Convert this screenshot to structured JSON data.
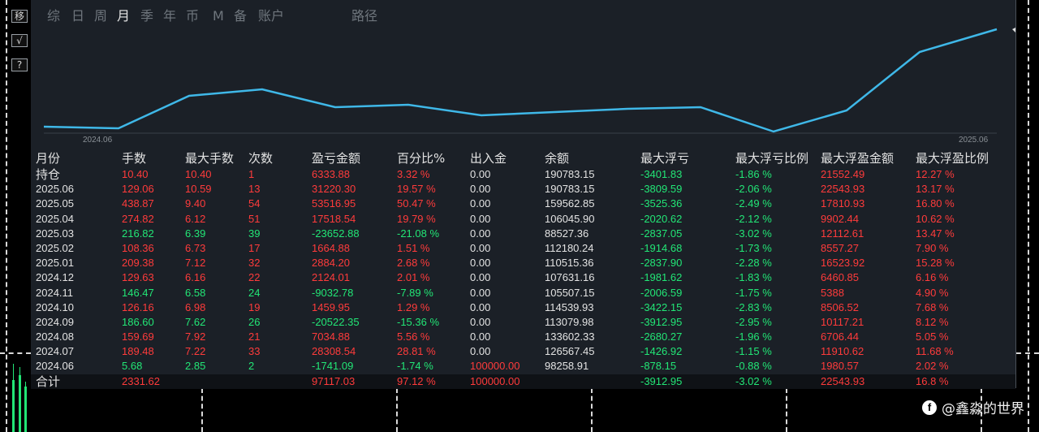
{
  "toolbar": {
    "move_label": "移",
    "check_label": "√",
    "help_label": "?"
  },
  "tabs": [
    {
      "label": "综",
      "active": false
    },
    {
      "label": "日",
      "active": false
    },
    {
      "label": "周",
      "active": false
    },
    {
      "label": "月",
      "active": true
    },
    {
      "label": "季",
      "active": false
    },
    {
      "label": "年",
      "active": false
    },
    {
      "label": "币",
      "active": false
    },
    {
      "label": "M",
      "active": false
    },
    {
      "label": "备",
      "active": false
    },
    {
      "label": "账户",
      "active": false
    },
    {
      "label": "路径",
      "active": false
    }
  ],
  "chart": {
    "x_start_label": "2024.06",
    "x_end_label": "2025.06",
    "line_color": "#3fb8e8",
    "series": [
      5.68,
      2.85,
      107631.16,
      110515.36,
      112180.24,
      88527.36,
      106045.9,
      159562.85,
      190783.15
    ]
  },
  "table": {
    "headers": [
      "月份",
      "手数",
      "最大手数",
      "次数",
      "盈亏金额",
      "百分比%",
      "出入金",
      "余额",
      "最大浮亏",
      "最大浮亏比例",
      "最大浮盈金额",
      "最大浮盈比例"
    ],
    "holding": {
      "label": "持仓",
      "lots": "10.40",
      "max_lots": "10.40",
      "count": "1",
      "pnl": "6333.88",
      "pct": "3.32 %",
      "flow": "0.00",
      "balance": "190783.15",
      "max_dd": "-3401.83",
      "max_dd_pct": "-1.86 %",
      "max_fp": "21552.49",
      "max_fp_pct": "12.27 %"
    },
    "rows": [
      {
        "month": "2025.06",
        "lots": "129.06",
        "max_lots": "10.59",
        "count": "13",
        "pnl": "31220.30",
        "pct": "19.57 %",
        "flow": "0.00",
        "balance": "190783.15",
        "max_dd": "-3809.59",
        "max_dd_pct": "-2.06 %",
        "max_fp": "22543.93",
        "max_fp_pct": "13.17 %",
        "sign": "pos"
      },
      {
        "month": "2025.05",
        "lots": "438.87",
        "max_lots": "9.40",
        "count": "54",
        "pnl": "53516.95",
        "pct": "50.47 %",
        "flow": "0.00",
        "balance": "159562.85",
        "max_dd": "-3525.36",
        "max_dd_pct": "-2.49 %",
        "max_fp": "17810.93",
        "max_fp_pct": "16.80 %",
        "sign": "pos"
      },
      {
        "month": "2025.04",
        "lots": "274.82",
        "max_lots": "6.12",
        "count": "51",
        "pnl": "17518.54",
        "pct": "19.79 %",
        "flow": "0.00",
        "balance": "106045.90",
        "max_dd": "-2020.62",
        "max_dd_pct": "-2.12 %",
        "max_fp": "9902.44",
        "max_fp_pct": "10.62 %",
        "sign": "pos"
      },
      {
        "month": "2025.03",
        "lots": "216.82",
        "max_lots": "6.39",
        "count": "39",
        "pnl": "-23652.88",
        "pct": "-21.08 %",
        "flow": "0.00",
        "balance": "88527.36",
        "max_dd": "-2837.05",
        "max_dd_pct": "-3.02 %",
        "max_fp": "12112.61",
        "max_fp_pct": "13.47 %",
        "sign": "neg"
      },
      {
        "month": "2025.02",
        "lots": "108.36",
        "max_lots": "6.73",
        "count": "17",
        "pnl": "1664.88",
        "pct": "1.51 %",
        "flow": "0.00",
        "balance": "112180.24",
        "max_dd": "-1914.68",
        "max_dd_pct": "-1.73 %",
        "max_fp": "8557.27",
        "max_fp_pct": "7.90 %",
        "sign": "pos"
      },
      {
        "month": "2025.01",
        "lots": "209.38",
        "max_lots": "7.12",
        "count": "32",
        "pnl": "2884.20",
        "pct": "2.68 %",
        "flow": "0.00",
        "balance": "110515.36",
        "max_dd": "-2837.90",
        "max_dd_pct": "-2.28 %",
        "max_fp": "16523.92",
        "max_fp_pct": "15.28 %",
        "sign": "pos"
      },
      {
        "month": "2024.12",
        "lots": "129.63",
        "max_lots": "6.16",
        "count": "22",
        "pnl": "2124.01",
        "pct": "2.01 %",
        "flow": "0.00",
        "balance": "107631.16",
        "max_dd": "-1981.62",
        "max_dd_pct": "-1.83 %",
        "max_fp": "6460.85",
        "max_fp_pct": "6.16 %",
        "sign": "pos"
      },
      {
        "month": "2024.11",
        "lots": "146.47",
        "max_lots": "6.58",
        "count": "24",
        "pnl": "-9032.78",
        "pct": "-7.89 %",
        "flow": "0.00",
        "balance": "105507.15",
        "max_dd": "-2006.59",
        "max_dd_pct": "-1.75 %",
        "max_fp": "5388",
        "max_fp_pct": "4.90 %",
        "sign": "neg"
      },
      {
        "month": "2024.10",
        "lots": "126.16",
        "max_lots": "6.98",
        "count": "19",
        "pnl": "1459.95",
        "pct": "1.29 %",
        "flow": "0.00",
        "balance": "114539.93",
        "max_dd": "-3422.15",
        "max_dd_pct": "-2.83 %",
        "max_fp": "8506.52",
        "max_fp_pct": "7.68 %",
        "sign": "pos"
      },
      {
        "month": "2024.09",
        "lots": "186.60",
        "max_lots": "7.62",
        "count": "26",
        "pnl": "-20522.35",
        "pct": "-15.36 %",
        "flow": "0.00",
        "balance": "113079.98",
        "max_dd": "-3912.95",
        "max_dd_pct": "-2.95 %",
        "max_fp": "10117.21",
        "max_fp_pct": "8.12 %",
        "sign": "neg"
      },
      {
        "month": "2024.08",
        "lots": "159.69",
        "max_lots": "7.92",
        "count": "21",
        "pnl": "7034.88",
        "pct": "5.56 %",
        "flow": "0.00",
        "balance": "133602.33",
        "max_dd": "-2680.27",
        "max_dd_pct": "-1.96 %",
        "max_fp": "6706.44",
        "max_fp_pct": "5.05 %",
        "sign": "pos"
      },
      {
        "month": "2024.07",
        "lots": "189.48",
        "max_lots": "7.22",
        "count": "33",
        "pnl": "28308.54",
        "pct": "28.81 %",
        "flow": "0.00",
        "balance": "126567.45",
        "max_dd": "-1426.92",
        "max_dd_pct": "-1.15 %",
        "max_fp": "11910.62",
        "max_fp_pct": "11.68 %",
        "sign": "pos"
      },
      {
        "month": "2024.06",
        "lots": "5.68",
        "max_lots": "2.85",
        "count": "2",
        "pnl": "-1741.09",
        "pct": "-1.74 %",
        "flow": "100000.00",
        "balance": "98258.91",
        "max_dd": "-878.15",
        "max_dd_pct": "-0.88 %",
        "max_fp": "1980.57",
        "max_fp_pct": "2.02 %",
        "sign": "neg"
      }
    ],
    "total": {
      "label": "合计",
      "lots": "2331.62",
      "pnl": "97117.03",
      "pct": "97.12 %",
      "flow": "100000.00",
      "max_dd": "-3912.95",
      "max_dd_pct": "-3.02 %",
      "max_fp": "22543.93",
      "max_fp_pct": "16.8 %"
    }
  },
  "watermark": {
    "icon": "f",
    "text": "@鑫淼的世界"
  }
}
